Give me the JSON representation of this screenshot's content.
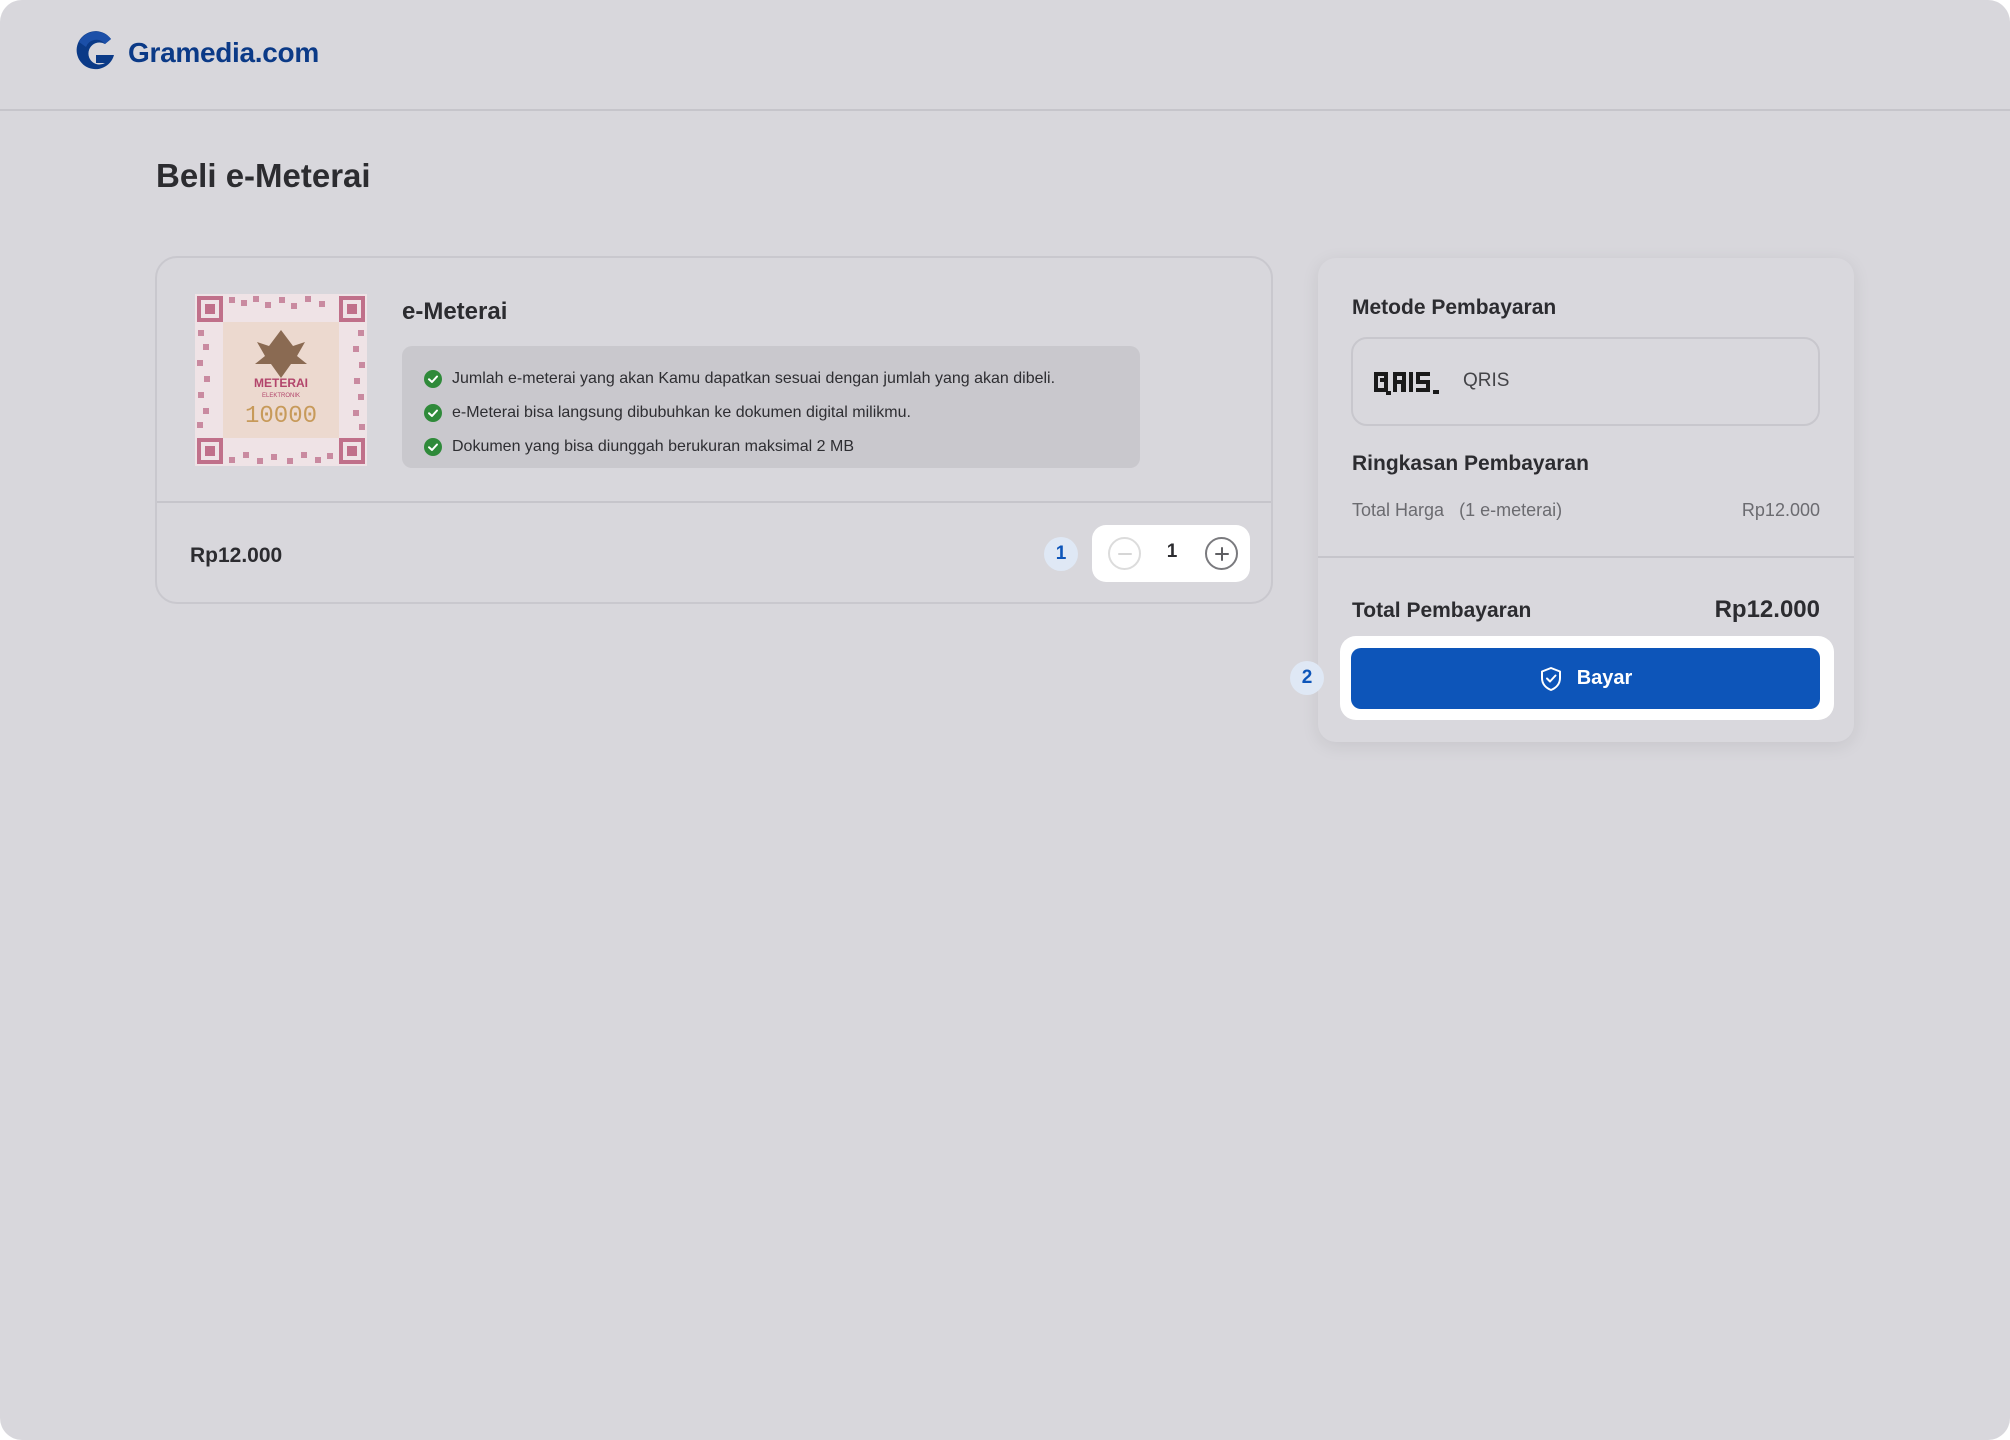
{
  "header": {
    "logo_text": "Gramedia.com"
  },
  "page": {
    "title": "Beli e-Meterai"
  },
  "product": {
    "name": "e-Meterai",
    "stamp_image": "e-meterai-stamp",
    "stamp_text": [
      "METERAI",
      "ELEKTRONIK",
      "10000"
    ],
    "benefits": [
      "Jumlah e-meterai yang akan Kamu dapatkan sesuai dengan jumlah yang akan dibeli.",
      "e-Meterai bisa langsung dibubuhkan ke dokumen digital milikmu.",
      "Dokumen yang bisa diunggah berukuran maksimal 2 MB"
    ],
    "price": "Rp12.000",
    "quantity": "1"
  },
  "steps": {
    "step1": "1",
    "step2": "2"
  },
  "payment": {
    "method_title": "Metode Pembayaran",
    "method_name": "QRIS",
    "summary_title": "Ringkasan Pembayaran",
    "total_harga_label": "Total Harga",
    "total_harga_qty": "(1 e-meterai)",
    "total_harga_value": "Rp12.000",
    "total_pembayaran_label": "Total Pembayaran",
    "total_pembayaran_value": "Rp12.000",
    "pay_button_label": "Bayar"
  },
  "icons": {
    "check": "check-circle-icon",
    "minus": "minus-icon",
    "plus": "plus-icon",
    "shield": "shield-check-icon",
    "qris": "qris-logo"
  },
  "colors": {
    "background": "#d8d7dc",
    "brand_blue": "#0d55b9",
    "logo_blue": "#0b3a87",
    "check_green": "#2f8a3a"
  }
}
